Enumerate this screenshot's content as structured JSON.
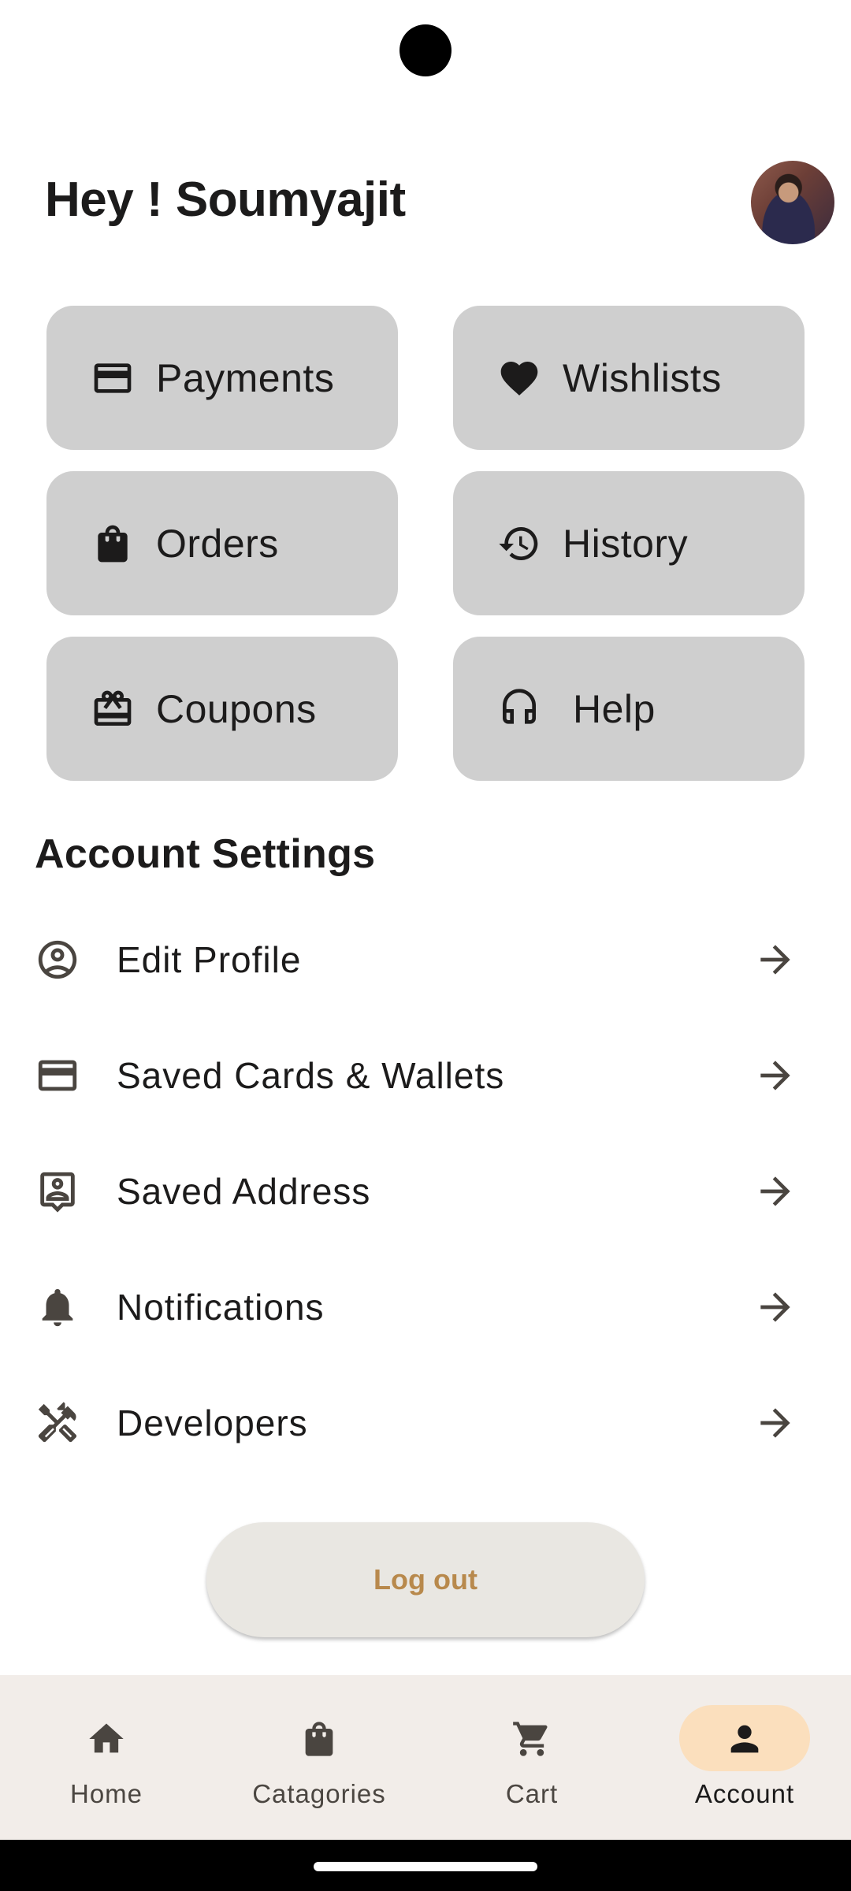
{
  "header": {
    "greeting": "Hey ! Soumyajit"
  },
  "tiles": [
    {
      "label": "Payments",
      "icon": "credit-card-icon"
    },
    {
      "label": "Wishlists",
      "icon": "heart-icon"
    },
    {
      "label": "Orders",
      "icon": "shopping-bag-icon"
    },
    {
      "label": "History",
      "icon": "history-icon"
    },
    {
      "label": "Coupons",
      "icon": "gift-card-icon"
    },
    {
      "label": "Help",
      "icon": "headset-icon"
    }
  ],
  "settings": {
    "title": "Account Settings",
    "items": [
      {
        "label": "Edit Profile",
        "icon": "account-circle-icon"
      },
      {
        "label": "Saved Cards & Wallets",
        "icon": "credit-card-icon"
      },
      {
        "label": "Saved Address",
        "icon": "contact-address-icon"
      },
      {
        "label": "Notifications",
        "icon": "bell-icon"
      },
      {
        "label": "Developers",
        "icon": "tools-icon"
      }
    ]
  },
  "logout": {
    "label": "Log out"
  },
  "nav": {
    "items": [
      {
        "label": "Home",
        "icon": "home-icon"
      },
      {
        "label": "Catagories",
        "icon": "shopping-bag-icon"
      },
      {
        "label": "Cart",
        "icon": "cart-icon"
      },
      {
        "label": "Account",
        "icon": "person-icon"
      }
    ],
    "active": "Account"
  },
  "colors": {
    "tile_bg": "#cfcfcf",
    "logout_text": "#b8894c",
    "nav_bg": "#f2ede9",
    "nav_active_pill": "#fbdfbd"
  }
}
